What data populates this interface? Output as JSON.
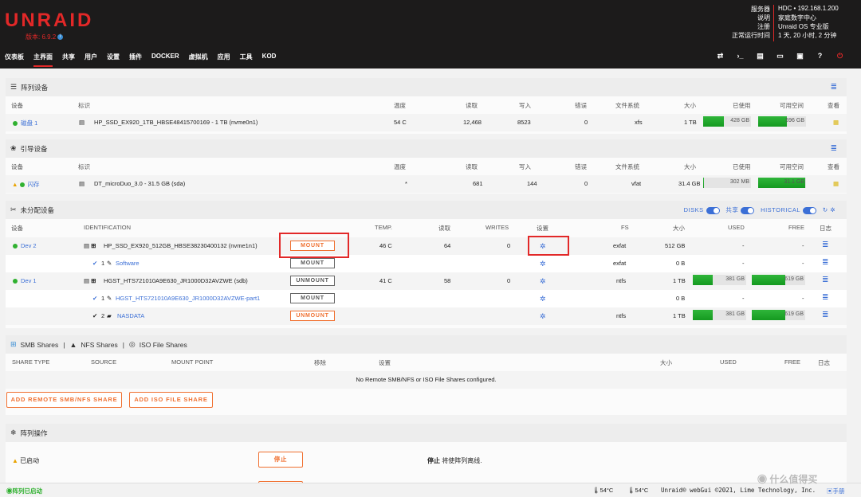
{
  "header": {
    "logo": "UNRAID",
    "version_label": "版本: 6.9.2",
    "sys": [
      {
        "k": "服务器",
        "v": "HDC • 192.168.1.200"
      },
      {
        "k": "说明",
        "v": "家庭数字中心"
      },
      {
        "k": "注册",
        "v": "Unraid OS 专业版"
      },
      {
        "k": "正常运行时间",
        "v": "1 天, 20 小时, 2 分钟"
      }
    ]
  },
  "nav": [
    "仪表板",
    "主界面",
    "共享",
    "用户",
    "设置",
    "插件",
    "DOCKER",
    "虚拟机",
    "应用",
    "工具",
    "KOD"
  ],
  "nav_active": 1,
  "navicons": [
    "⇄",
    "›_",
    "▤",
    "▭",
    "▣",
    "?",
    "⏻"
  ],
  "array": {
    "title": "阵列设备",
    "cols": [
      "设备",
      "标识",
      "温度",
      "读取",
      "写入",
      "错误",
      "文件系统",
      "大小",
      "已使用",
      "可用空间",
      "查看"
    ],
    "row": {
      "device": "磁盘 1",
      "id": "HP_SSD_EX920_1TB_HBSE48415700169 - 1 TB (nvme0n1)",
      "temp": "54 C",
      "reads": "12,468",
      "writes": "8523",
      "errors": "0",
      "fs": "xfs",
      "size": "1 TB",
      "used": "428 GB",
      "free": "596 GB",
      "used_frac": 0.43,
      "free_frac": 0.6
    }
  },
  "boot": {
    "title": "引导设备",
    "cols": [
      "设备",
      "标识",
      "温度",
      "读取",
      "写入",
      "错误",
      "文件系统",
      "大小",
      "已使用",
      "可用空间",
      "查看"
    ],
    "row": {
      "device": "闪存",
      "id": "DT_microDuo_3.0 - 31.5 GB (sda)",
      "temp": "*",
      "reads": "681",
      "writes": "144",
      "errors": "0",
      "fs": "vfat",
      "size": "31.4 GB",
      "used": "302 MB",
      "free": "31.1 GB",
      "used_frac": 0.01,
      "free_frac": 0.99
    }
  },
  "unassigned": {
    "title": "未分配设备",
    "toggles": [
      "DISKS",
      "共享",
      "HISTORICAL"
    ],
    "cols": [
      "设备",
      "IDENTIFICATION",
      "TEMP.",
      "读取",
      "WRITES",
      "设置",
      "FS",
      "大小",
      "USED",
      "FREE",
      "日志"
    ],
    "rows": [
      {
        "device": "Dev 2",
        "id": "HP_SSD_EX920_512GB_HBSE38230400132 (nvme1n1)",
        "btn": "MOUNT",
        "temp": "46 C",
        "reads": "64",
        "writes": "0",
        "fs": "exfat",
        "size": "512 GB",
        "used": "-",
        "free": "-"
      },
      {
        "device": "",
        "id": "Software",
        "part": "1",
        "btn": "MOUNT",
        "temp": "",
        "reads": "",
        "writes": "",
        "fs": "exfat",
        "size": "0 B",
        "used": "-",
        "free": "-"
      },
      {
        "device": "Dev 1",
        "id": "HGST_HTS721010A9E630_JR1000D32AVZWE (sdb)",
        "btn": "UNMOUNT",
        "temp": "41 C",
        "reads": "58",
        "writes": "0",
        "fs": "ntfs",
        "size": "1 TB",
        "used": "381 GB",
        "free": "619 GB",
        "used_frac": 0.38,
        "free_frac": 0.62
      },
      {
        "device": "",
        "id": "HGST_HTS721010A9E630_JR1000D32AVZWE-part1",
        "part": "1",
        "btn": "MOUNT",
        "temp": "",
        "reads": "",
        "writes": "",
        "fs": "",
        "size": "0 B",
        "used": "-",
        "free": "-"
      },
      {
        "device": "",
        "id": "NASDATA",
        "part": "2",
        "btn": "UNMOUNT",
        "temp": "",
        "reads": "",
        "writes": "",
        "fs": "ntfs",
        "size": "1 TB",
        "used": "381 GB",
        "free": "619 GB",
        "used_frac": 0.38,
        "free_frac": 0.62
      }
    ]
  },
  "shares": {
    "title_smb": "SMB Shares",
    "title_nfs": "NFS Shares",
    "title_iso": "ISO File Shares",
    "cols": [
      "SHARE TYPE",
      "SOURCE",
      "MOUNT POINT",
      "移除",
      "设置",
      "大小",
      "USED",
      "FREE",
      "日志"
    ],
    "empty": "No Remote SMB/NFS or ISO File Shares configured.",
    "btn_remote": "ADD REMOTE SMB/NFS SHARE",
    "btn_iso": "ADD ISO FILE SHARE"
  },
  "ops": {
    "title": "阵列操作",
    "status": "已启动",
    "stop_btn": "停止",
    "stop_desc_bold": "停止",
    "stop_desc": " 将使阵列离线."
  },
  "footer": {
    "status": "阵列已启动",
    "temp1": "54°C",
    "temp2": "54°C",
    "copyright": "Unraid® webGui ©2021, Lime Technology, Inc.",
    "manual": "手册",
    "watermark": "什么值得买"
  },
  "colors": {
    "brand": "#e22828",
    "accent": "#3b6fd6",
    "orange": "#f07030",
    "green": "#30b130"
  }
}
